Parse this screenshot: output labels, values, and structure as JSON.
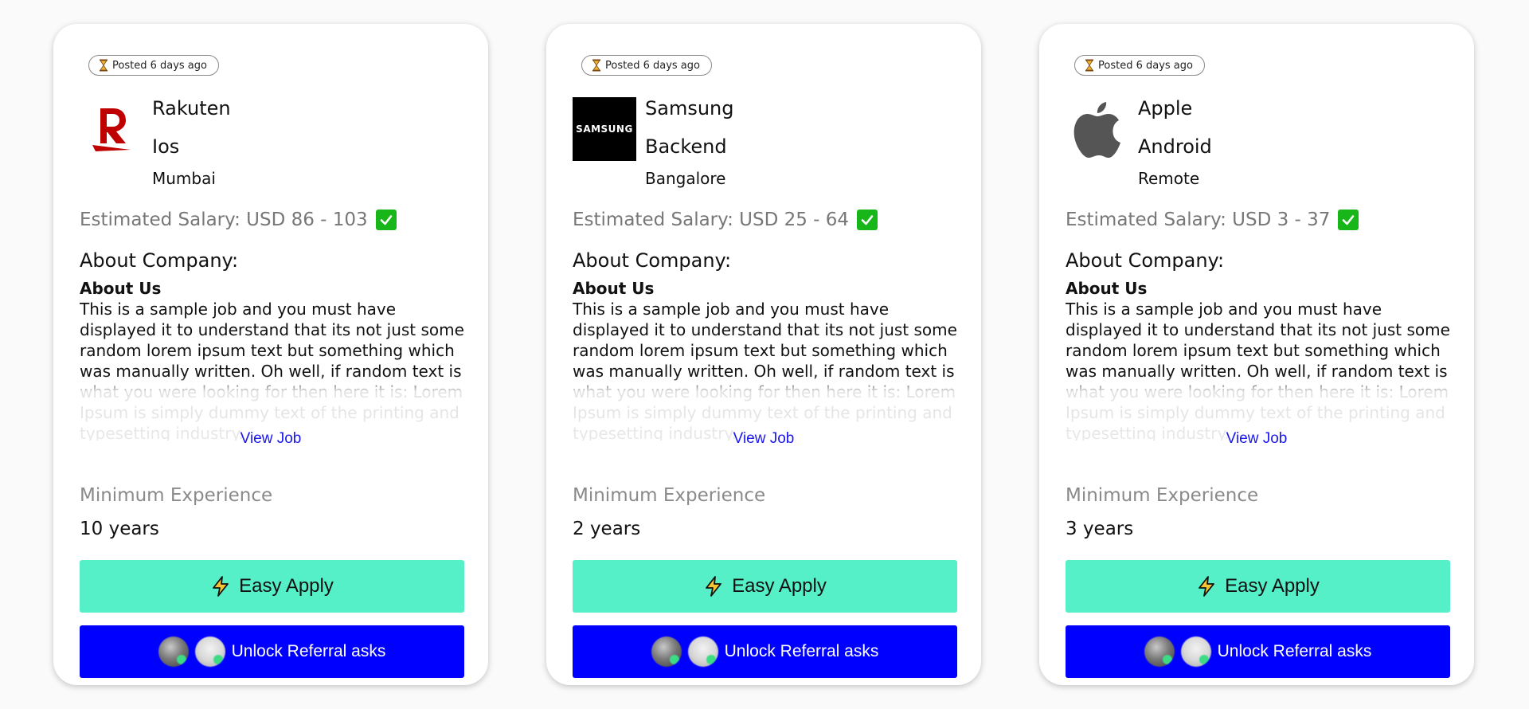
{
  "jobs": [
    {
      "posted": "Posted 6 days ago",
      "logo": "rakuten-logo",
      "company": "Rakuten",
      "role": "Ios",
      "location": "Mumbai",
      "salary": "Estimated Salary: USD 86 - 103",
      "about_heading": "About Company:",
      "about_subheading": "About Us",
      "description": "This is a sample job and you must have displayed it to understand that its not just some random lorem ipsum text but something which was manually written. Oh well, if random text is what you were looking for then here it is: Lorem Ipsum is simply dummy text of the printing and typesetting industry. ...",
      "view_job": "View Job",
      "min_exp_label": "Minimum Experience",
      "min_exp_value": "10 years",
      "easy_apply": "Easy Apply",
      "referral": "Unlock Referral asks"
    },
    {
      "posted": "Posted 6 days ago",
      "logo": "samsung-logo",
      "logo_text": "SAMSUNG",
      "company": "Samsung",
      "role": "Backend",
      "location": "Bangalore",
      "salary": "Estimated Salary: USD 25 - 64",
      "about_heading": "About Company:",
      "about_subheading": "About Us",
      "description": "This is a sample job and you must have displayed it to understand that its not just some random lorem ipsum text but something which was manually written. Oh well, if random text is what you were looking for then here it is: Lorem Ipsum is simply dummy text of the printing and typesetting industry. ...",
      "view_job": "View Job",
      "min_exp_label": "Minimum Experience",
      "min_exp_value": "2 years",
      "easy_apply": "Easy Apply",
      "referral": "Unlock Referral asks"
    },
    {
      "posted": "Posted 6 days ago",
      "logo": "apple-logo",
      "company": "Apple",
      "role": "Android",
      "location": "Remote",
      "salary": "Estimated Salary: USD 3 - 37",
      "about_heading": "About Company:",
      "about_subheading": "About Us",
      "description": "This is a sample job and you must have displayed it to understand that its not just some random lorem ipsum text but something which was manually written. Oh well, if random text is what you were looking for then here it is: Lorem Ipsum is simply dummy text of the printing and typesetting industry. ...",
      "view_job": "View Job",
      "min_exp_label": "Minimum Experience",
      "min_exp_value": "3 years",
      "easy_apply": "Easy Apply",
      "referral": "Unlock Referral asks"
    }
  ],
  "colors": {
    "easy_apply_bg": "#55f0c8",
    "referral_bg": "#0000ff",
    "link": "#1a17ee",
    "salary_check": "#19b619",
    "rakuten_red": "#bf0000"
  },
  "icons": {
    "posted": "hourglass-icon",
    "salary": "check-mark-icon",
    "easy_apply": "lightning-bolt-icon"
  }
}
